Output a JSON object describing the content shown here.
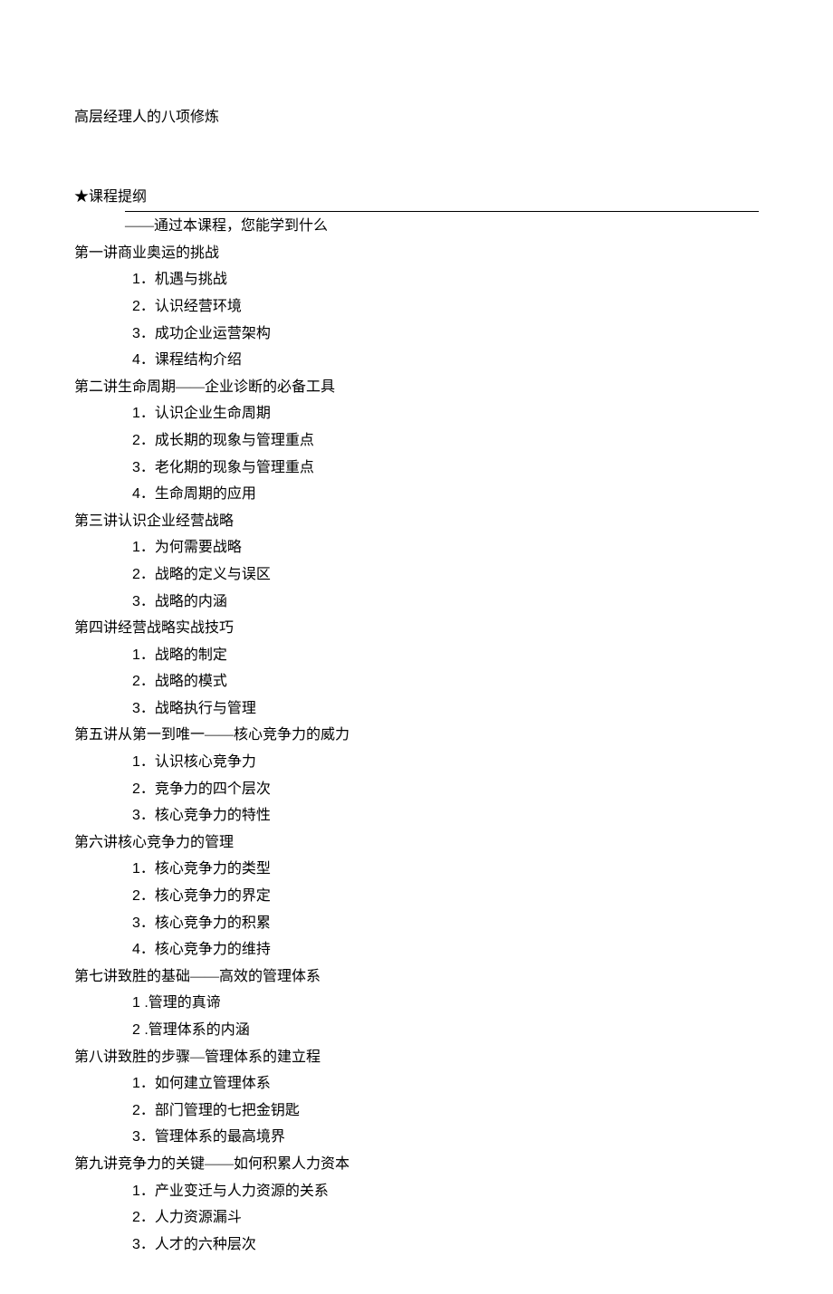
{
  "title": "高层经理人的八项修炼",
  "outlineHeader": "★课程提纲",
  "subtitle": "——通过本课程，您能学到什么",
  "sections": [
    {
      "title": "第一讲商业奥运的挑战",
      "items": [
        {
          "num": "1．",
          "text": "机遇与挑战"
        },
        {
          "num": "2．",
          "text": "认识经营环境"
        },
        {
          "num": "3．",
          "text": "成功企业运营架构"
        },
        {
          "num": "4．",
          "text": "课程结构介绍"
        }
      ]
    },
    {
      "title": "第二讲生命周期——企业诊断的必备工具",
      "items": [
        {
          "num": "1．",
          "text": "认识企业生命周期"
        },
        {
          "num": "2．",
          "text": "成长期的现象与管理重点"
        },
        {
          "num": "3．",
          "text": "老化期的现象与管理重点"
        },
        {
          "num": "4．",
          "text": "生命周期的应用"
        }
      ]
    },
    {
      "title": "第三讲认识企业经营战略",
      "items": [
        {
          "num": "1．",
          "text": "为何需要战略"
        },
        {
          "num": "2．",
          "text": "战略的定义与误区"
        },
        {
          "num": "3．",
          "text": "战略的内涵"
        }
      ]
    },
    {
      "title": "第四讲经营战略实战技巧",
      "items": [
        {
          "num": "1．",
          "text": "战略的制定"
        },
        {
          "num": "2．",
          "text": "战略的模式"
        },
        {
          "num": "3．",
          "text": "战略执行与管理"
        }
      ]
    },
    {
      "title": "第五讲从第一到唯一——核心竞争力的威力",
      "items": [
        {
          "num": "1．",
          "text": "认识核心竞争力"
        },
        {
          "num": "2．",
          "text": "竞争力的四个层次"
        },
        {
          "num": "3．",
          "text": "核心竞争力的特性"
        }
      ]
    },
    {
      "title": "第六讲核心竞争力的管理",
      "items": [
        {
          "num": "1．",
          "text": "核心竞争力的类型"
        },
        {
          "num": "2．",
          "text": "核心竞争力的界定"
        },
        {
          "num": "3．",
          "text": "核心竞争力的积累"
        },
        {
          "num": "4．",
          "text": "核心竞争力的维持"
        }
      ]
    },
    {
      "title": "第七讲致胜的基础——高效的管理体系",
      "items": [
        {
          "num": "1 .",
          "text": "管理的真谛"
        },
        {
          "num": "2 .",
          "text": "管理体系的内涵"
        }
      ]
    },
    {
      "title": "第八讲致胜的步骤—管理体系的建立程",
      "items": [
        {
          "num": "1．",
          "text": "如何建立管理体系"
        },
        {
          "num": "2．",
          "text": "部门管理的七把金钥匙"
        },
        {
          "num": "3．",
          "text": "管理体系的最高境界"
        }
      ]
    },
    {
      "title": "第九讲竞争力的关键——如何积累人力资本",
      "items": [
        {
          "num": "1．",
          "text": "产业变迁与人力资源的关系"
        },
        {
          "num": "2．",
          "text": "人力资源漏斗"
        },
        {
          "num": "3．",
          "text": "人才的六种层次"
        }
      ]
    }
  ]
}
